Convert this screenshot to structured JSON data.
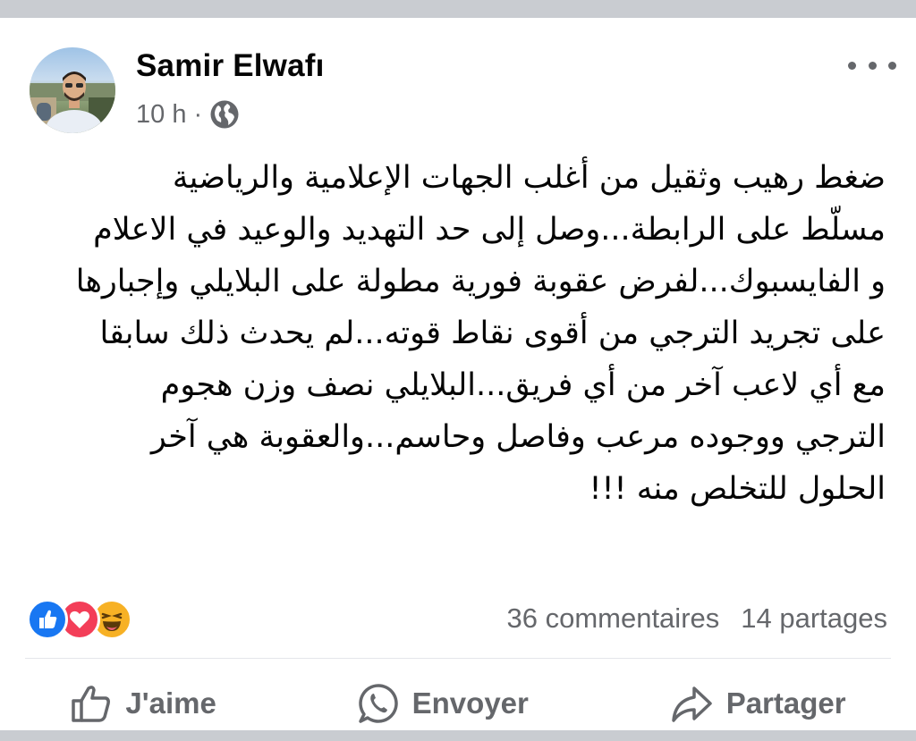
{
  "post": {
    "author": "Samir Elwafı",
    "time": "10 h",
    "separator": "·",
    "privacy_icon": "globe-icon",
    "text": "ضغط رهيب وثقيل من أغلب الجهات الإعلامية والرياضية\nمسلّط على الرابطة...وصل إلى حد التهديد والوعيد في الاعلام\nو الفايسبوك...لفرض عقوبة فورية مطولة على البلايلي وإجبارها\nعلى تجريد الترجي من أقوى نقاط قوته...لم يحدث ذلك سابقا\nمع أي لاعب آخر من أي فريق...البلايلي نصف وزن هجوم\nالترجي ووجوده مرعب وفاصل وحاسم...والعقوبة هي آخر\nالحلول للتخلص منه !!!"
  },
  "stats": {
    "reaction_icons": [
      "like-icon",
      "love-icon",
      "haha-icon"
    ],
    "comments": "36 commentaires",
    "shares": "14 partages"
  },
  "actions": {
    "like_label": "J'aime",
    "send_label": "Envoyer",
    "share_label": "Partager"
  },
  "colors": {
    "secondary_text": "#65676b",
    "like_blue": "#1877f2",
    "love_red": "#f33e58",
    "haha_yellow": "#f7b125"
  }
}
